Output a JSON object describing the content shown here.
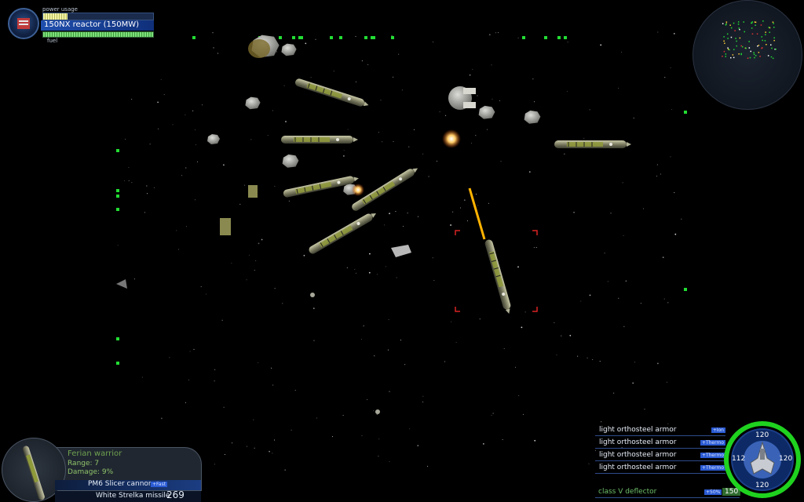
{
  "reactor": {
    "power_label": "power usage",
    "power_level": 0.22,
    "name": "150NX reactor (150MW)",
    "fuel_label": "fuel",
    "fuel_level": 1.0
  },
  "target": {
    "name": "Ferian warrior",
    "range": "Range: 7",
    "damage": "Damage: 9%"
  },
  "weapons": {
    "primary": "PM6 Slicer cannon",
    "primary_badge": "+Fast",
    "missile": "White Strelka missile",
    "missile_count": "269"
  },
  "armor": [
    {
      "label": "light orthosteel armor",
      "badge": "+Ion"
    },
    {
      "label": "light orthosteel armor",
      "badge": "+Thermo"
    },
    {
      "label": "light orthosteel armor",
      "badge": "+Thermo"
    },
    {
      "label": "light orthosteel armor",
      "badge": "+Thermo"
    }
  ],
  "deflector": {
    "label": "class V deflector",
    "badge": "+50%",
    "value": "150"
  },
  "shields": {
    "top": "120",
    "left": "112",
    "right": "120",
    "bottom": "120"
  },
  "colors": {
    "hud_blue": "#1f4fae",
    "hud_green": "#22dd33",
    "target_bracket": "#d92323",
    "beam": "#ffb300"
  },
  "icons": [
    "reactor-emblem-icon",
    "target-ship-icon",
    "player-ship-icon"
  ]
}
